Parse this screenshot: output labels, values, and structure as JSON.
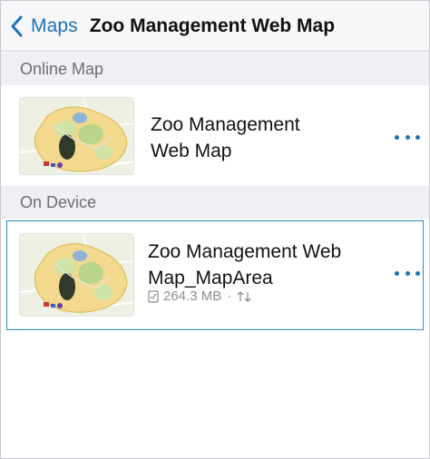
{
  "navbar": {
    "back_label": "Maps",
    "title": "Zoo Management Web Map"
  },
  "sections": {
    "online": {
      "header": "Online Map",
      "item": {
        "title_line1": "Zoo Management",
        "title_line2": "Web Map"
      }
    },
    "device": {
      "header": "On Device",
      "item": {
        "title_line1": "Zoo Management Web",
        "title_line2": "Map_MapArea",
        "size": "264.3 MB",
        "separator": "·"
      }
    }
  },
  "icons": {
    "back": "chevron-left-icon",
    "more": "ellipsis-icon",
    "downloaded": "checklist-icon",
    "sync": "sync-arrows-icon"
  },
  "colors": {
    "accent": "#1b73b9",
    "selection_border": "#2b8dbf",
    "section_bg": "#efeff4"
  }
}
